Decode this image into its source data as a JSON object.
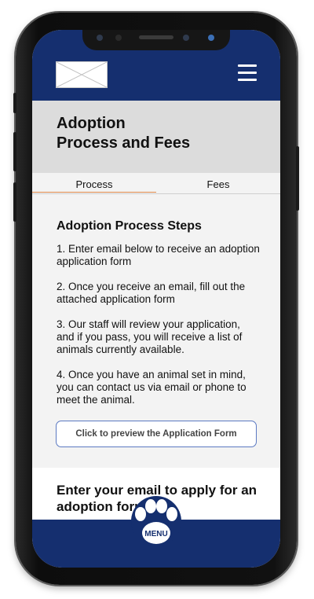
{
  "header": {
    "logo_alt": "logo placeholder",
    "menu_icon": "hamburger-menu-icon"
  },
  "hero": {
    "title": "Adoption\nProcess and Fees"
  },
  "tabs": [
    {
      "label": "Process",
      "active": true
    },
    {
      "label": "Fees",
      "active": false
    }
  ],
  "process": {
    "heading": "Adoption Process Steps",
    "steps": [
      "1. Enter email below to receive an adoption application form",
      "2. Once you receive an email, fill out the attached application form",
      "3. Our staff will review your application, and if you pass, you will receive a list of animals currently available.",
      "4. Once you have an animal set in mind, you can contact us via email or phone to meet the animal."
    ],
    "preview_button": "Click to preview the Application Form"
  },
  "email_section": {
    "heading": "Enter your email to apply for an adoption form"
  },
  "bottom_menu": {
    "label": "MENU",
    "icon": "paw-icon"
  },
  "colors": {
    "brand_navy": "#152f6f",
    "tab_underline": "#e08a4b",
    "button_border": "#5b79c2"
  }
}
